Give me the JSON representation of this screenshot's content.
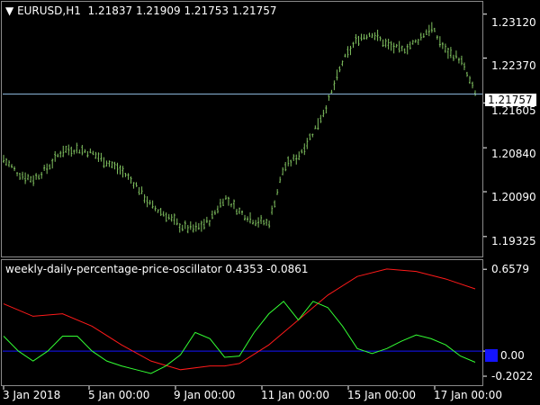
{
  "header": {
    "symbol_arrow": "▼",
    "symbol": "EURUSD,H1",
    "open": "1.21837",
    "high": "1.21909",
    "low": "1.21753",
    "close": "1.21757"
  },
  "indicator": {
    "name": "weekly-daily-percentage-price-oscillator",
    "value1": "0.4353",
    "value2": "-0.0861"
  },
  "price_scale": [
    "1.23120",
    "1.22370",
    "1.21605",
    "1.20840",
    "1.20090",
    "1.19325"
  ],
  "current_price": "1.21757",
  "osc_scale": [
    "0.6579",
    "0.00",
    "-0.2022"
  ],
  "time_axis": [
    "3 Jan 2018",
    "5 Jan 00:00",
    "9 Jan 00:00",
    "11 Jan 00:00",
    "15 Jan 00:00",
    "17 Jan 00:00"
  ],
  "colors": {
    "candles": "#7fbf5f",
    "current_price_line": "#8ab4d8",
    "signal_line": "#ff1a1a",
    "oscillator_line": "#33ff33",
    "zero_line": "#1414ff",
    "frame": "#8a8a8a"
  },
  "chart_data": [
    {
      "type": "line",
      "title": "EURUSD,H1",
      "series": [
        {
          "name": "EURUSD",
          "x": [
            0,
            5,
            10,
            15,
            20,
            25,
            30,
            35,
            40,
            45,
            50,
            55,
            60,
            65,
            70,
            75,
            80,
            85,
            90,
            95,
            100,
            105,
            110,
            115,
            120,
            125,
            130,
            135,
            140,
            145,
            150,
            155,
            160
          ],
          "values": [
            1.2065,
            1.204,
            1.203,
            1.205,
            1.208,
            1.2082,
            1.2075,
            1.206,
            1.2045,
            1.202,
            1.1985,
            1.197,
            1.195,
            1.1945,
            1.196,
            1.2,
            1.1975,
            1.196,
            1.1955,
            1.205,
            1.207,
            1.211,
            1.216,
            1.223,
            1.227,
            1.228,
            1.226,
            1.225,
            1.2265,
            1.229,
            1.225,
            1.2235,
            1.2176
          ]
        }
      ],
      "ylim": [
        1.19,
        1.233
      ]
    },
    {
      "type": "line",
      "title": "weekly-daily-percentage-price-oscillator",
      "series": [
        {
          "x": [
            0,
            10,
            20,
            30,
            40,
            50,
            60,
            70,
            75,
            80,
            90,
            100,
            110,
            120,
            130,
            140,
            150,
            160
          ],
          "values": [
            0.38,
            0.28,
            0.3,
            0.2,
            0.05,
            -0.08,
            -0.15,
            -0.12,
            -0.12,
            -0.1,
            0.05,
            0.25,
            0.45,
            0.6,
            0.66,
            0.64,
            0.58,
            0.5
          ]
        },
        {
          "x": [
            0,
            5,
            10,
            15,
            20,
            25,
            30,
            35,
            40,
            45,
            50,
            55,
            60,
            65,
            70,
            75,
            80,
            85,
            90,
            95,
            100,
            105,
            110,
            115,
            120,
            125,
            130,
            135,
            140,
            145,
            150,
            155,
            160
          ],
          "values": [
            0.12,
            0.0,
            -0.08,
            0.0,
            0.12,
            0.12,
            0.0,
            -0.08,
            -0.12,
            -0.15,
            -0.18,
            -0.12,
            -0.03,
            0.15,
            0.1,
            -0.05,
            -0.04,
            0.15,
            0.3,
            0.4,
            0.25,
            0.4,
            0.35,
            0.2,
            0.02,
            -0.02,
            0.02,
            0.08,
            0.13,
            0.1,
            0.05,
            -0.04,
            -0.09
          ]
        }
      ],
      "ylim": [
        -0.26,
        0.71
      ]
    }
  ]
}
